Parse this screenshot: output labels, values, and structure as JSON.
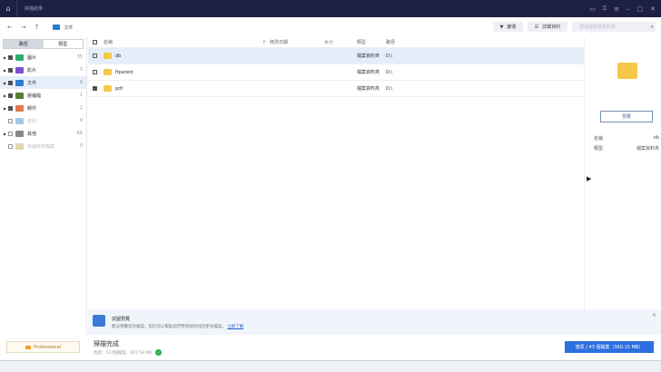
{
  "title": "掃描結果",
  "crumb": "文件",
  "toolbar": {
    "filter": "篩選",
    "details": "詳細資料",
    "search_placeholder": "搜尋檔案或資料夾"
  },
  "sidebar": {
    "tabs": [
      "路徑",
      "類型"
    ],
    "items": [
      {
        "label": "圖片",
        "count": "35",
        "checked": true,
        "color": "#2fae6a"
      },
      {
        "label": "影片",
        "count": "3",
        "checked": true,
        "color": "#7b4fcf"
      },
      {
        "label": "文件",
        "count": "6",
        "checked": true,
        "color": "#2a7dd1"
      },
      {
        "label": "壓縮檔",
        "count": "1",
        "checked": true,
        "color": "#5a7a3a"
      },
      {
        "label": "郵件",
        "count": "2",
        "checked": true,
        "color": "#e07a4a"
      },
      {
        "label": "音訊",
        "count": "0",
        "checked": false,
        "color": "#4a90c8"
      },
      {
        "label": "其他",
        "count": "66",
        "checked": false,
        "color": "#888"
      },
      {
        "label": "未儲存的檔案",
        "count": "0",
        "checked": false,
        "color": "#c8b060"
      }
    ]
  },
  "table": {
    "headers": [
      "名稱",
      "修改日期",
      "大小",
      "類型",
      "路徑"
    ],
    "rows": [
      {
        "name": "db",
        "type": "檔案資料夾",
        "path": "D:\\"
      },
      {
        "name": "ftparent",
        "type": "檔案資料夾",
        "path": "D:\\"
      },
      {
        "name": "pdf",
        "type": "檔案資料夾",
        "path": "D:\\"
      }
    ]
  },
  "preview": {
    "button": "預覽",
    "name_label": "名稱",
    "name": "db",
    "type_label": "類型",
    "type": "檔案資料夾"
  },
  "banner": {
    "title": "試圖預覽",
    "text": "無法預覽您的檔案，但仍可以幫助您們學習如何找回更多檔案。",
    "link": "立即了解"
  },
  "status": {
    "title": "掃描完成",
    "detail": "找到：137個檔案，367.59 MB"
  },
  "recover": "復原 | 43 個檔案（360.15 MB）",
  "pro": "Professional"
}
